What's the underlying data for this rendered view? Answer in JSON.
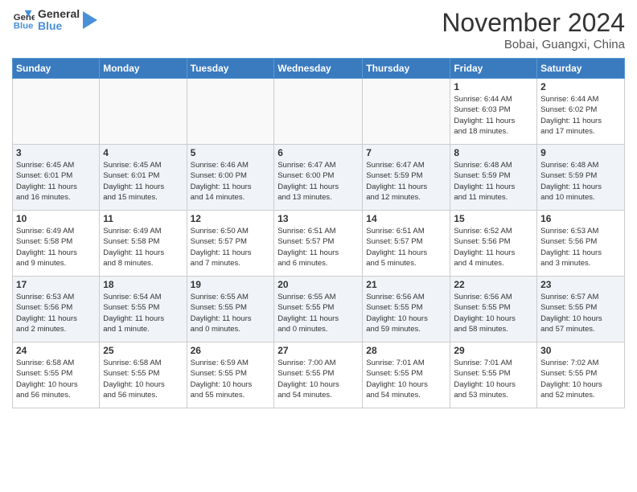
{
  "header": {
    "logo_general": "General",
    "logo_blue": "Blue",
    "month_title": "November 2024",
    "location": "Bobai, Guangxi, China"
  },
  "weekdays": [
    "Sunday",
    "Monday",
    "Tuesday",
    "Wednesday",
    "Thursday",
    "Friday",
    "Saturday"
  ],
  "weeks": [
    [
      {
        "day": "",
        "empty": true
      },
      {
        "day": "",
        "empty": true
      },
      {
        "day": "",
        "empty": true
      },
      {
        "day": "",
        "empty": true
      },
      {
        "day": "",
        "empty": true
      },
      {
        "day": "1",
        "lines": [
          "Sunrise: 6:44 AM",
          "Sunset: 6:03 PM",
          "Daylight: 11 hours",
          "and 18 minutes."
        ]
      },
      {
        "day": "2",
        "lines": [
          "Sunrise: 6:44 AM",
          "Sunset: 6:02 PM",
          "Daylight: 11 hours",
          "and 17 minutes."
        ]
      }
    ],
    [
      {
        "day": "3",
        "lines": [
          "Sunrise: 6:45 AM",
          "Sunset: 6:01 PM",
          "Daylight: 11 hours",
          "and 16 minutes."
        ]
      },
      {
        "day": "4",
        "lines": [
          "Sunrise: 6:45 AM",
          "Sunset: 6:01 PM",
          "Daylight: 11 hours",
          "and 15 minutes."
        ]
      },
      {
        "day": "5",
        "lines": [
          "Sunrise: 6:46 AM",
          "Sunset: 6:00 PM",
          "Daylight: 11 hours",
          "and 14 minutes."
        ]
      },
      {
        "day": "6",
        "lines": [
          "Sunrise: 6:47 AM",
          "Sunset: 6:00 PM",
          "Daylight: 11 hours",
          "and 13 minutes."
        ]
      },
      {
        "day": "7",
        "lines": [
          "Sunrise: 6:47 AM",
          "Sunset: 5:59 PM",
          "Daylight: 11 hours",
          "and 12 minutes."
        ]
      },
      {
        "day": "8",
        "lines": [
          "Sunrise: 6:48 AM",
          "Sunset: 5:59 PM",
          "Daylight: 11 hours",
          "and 11 minutes."
        ]
      },
      {
        "day": "9",
        "lines": [
          "Sunrise: 6:48 AM",
          "Sunset: 5:59 PM",
          "Daylight: 11 hours",
          "and 10 minutes."
        ]
      }
    ],
    [
      {
        "day": "10",
        "lines": [
          "Sunrise: 6:49 AM",
          "Sunset: 5:58 PM",
          "Daylight: 11 hours",
          "and 9 minutes."
        ]
      },
      {
        "day": "11",
        "lines": [
          "Sunrise: 6:49 AM",
          "Sunset: 5:58 PM",
          "Daylight: 11 hours",
          "and 8 minutes."
        ]
      },
      {
        "day": "12",
        "lines": [
          "Sunrise: 6:50 AM",
          "Sunset: 5:57 PM",
          "Daylight: 11 hours",
          "and 7 minutes."
        ]
      },
      {
        "day": "13",
        "lines": [
          "Sunrise: 6:51 AM",
          "Sunset: 5:57 PM",
          "Daylight: 11 hours",
          "and 6 minutes."
        ]
      },
      {
        "day": "14",
        "lines": [
          "Sunrise: 6:51 AM",
          "Sunset: 5:57 PM",
          "Daylight: 11 hours",
          "and 5 minutes."
        ]
      },
      {
        "day": "15",
        "lines": [
          "Sunrise: 6:52 AM",
          "Sunset: 5:56 PM",
          "Daylight: 11 hours",
          "and 4 minutes."
        ]
      },
      {
        "day": "16",
        "lines": [
          "Sunrise: 6:53 AM",
          "Sunset: 5:56 PM",
          "Daylight: 11 hours",
          "and 3 minutes."
        ]
      }
    ],
    [
      {
        "day": "17",
        "lines": [
          "Sunrise: 6:53 AM",
          "Sunset: 5:56 PM",
          "Daylight: 11 hours",
          "and 2 minutes."
        ]
      },
      {
        "day": "18",
        "lines": [
          "Sunrise: 6:54 AM",
          "Sunset: 5:55 PM",
          "Daylight: 11 hours",
          "and 1 minute."
        ]
      },
      {
        "day": "19",
        "lines": [
          "Sunrise: 6:55 AM",
          "Sunset: 5:55 PM",
          "Daylight: 11 hours",
          "and 0 minutes."
        ]
      },
      {
        "day": "20",
        "lines": [
          "Sunrise: 6:55 AM",
          "Sunset: 5:55 PM",
          "Daylight: 11 hours",
          "and 0 minutes."
        ]
      },
      {
        "day": "21",
        "lines": [
          "Sunrise: 6:56 AM",
          "Sunset: 5:55 PM",
          "Daylight: 10 hours",
          "and 59 minutes."
        ]
      },
      {
        "day": "22",
        "lines": [
          "Sunrise: 6:56 AM",
          "Sunset: 5:55 PM",
          "Daylight: 10 hours",
          "and 58 minutes."
        ]
      },
      {
        "day": "23",
        "lines": [
          "Sunrise: 6:57 AM",
          "Sunset: 5:55 PM",
          "Daylight: 10 hours",
          "and 57 minutes."
        ]
      }
    ],
    [
      {
        "day": "24",
        "lines": [
          "Sunrise: 6:58 AM",
          "Sunset: 5:55 PM",
          "Daylight: 10 hours",
          "and 56 minutes."
        ]
      },
      {
        "day": "25",
        "lines": [
          "Sunrise: 6:58 AM",
          "Sunset: 5:55 PM",
          "Daylight: 10 hours",
          "and 56 minutes."
        ]
      },
      {
        "day": "26",
        "lines": [
          "Sunrise: 6:59 AM",
          "Sunset: 5:55 PM",
          "Daylight: 10 hours",
          "and 55 minutes."
        ]
      },
      {
        "day": "27",
        "lines": [
          "Sunrise: 7:00 AM",
          "Sunset: 5:55 PM",
          "Daylight: 10 hours",
          "and 54 minutes."
        ]
      },
      {
        "day": "28",
        "lines": [
          "Sunrise: 7:01 AM",
          "Sunset: 5:55 PM",
          "Daylight: 10 hours",
          "and 54 minutes."
        ]
      },
      {
        "day": "29",
        "lines": [
          "Sunrise: 7:01 AM",
          "Sunset: 5:55 PM",
          "Daylight: 10 hours",
          "and 53 minutes."
        ]
      },
      {
        "day": "30",
        "lines": [
          "Sunrise: 7:02 AM",
          "Sunset: 5:55 PM",
          "Daylight: 10 hours",
          "and 52 minutes."
        ]
      }
    ]
  ]
}
